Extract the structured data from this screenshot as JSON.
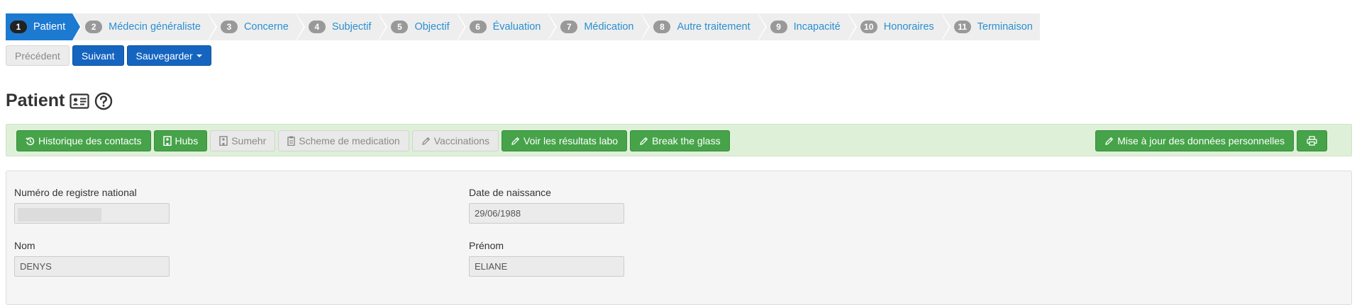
{
  "wizard": {
    "steps": [
      {
        "num": "1",
        "label": "Patient",
        "active": true
      },
      {
        "num": "2",
        "label": "Médecin généraliste"
      },
      {
        "num": "3",
        "label": "Concerne"
      },
      {
        "num": "4",
        "label": "Subjectif"
      },
      {
        "num": "5",
        "label": "Objectif"
      },
      {
        "num": "6",
        "label": "Évaluation"
      },
      {
        "num": "7",
        "label": "Médication"
      },
      {
        "num": "8",
        "label": "Autre traitement"
      },
      {
        "num": "9",
        "label": "Incapacité"
      },
      {
        "num": "10",
        "label": "Honoraires"
      },
      {
        "num": "11",
        "label": "Terminaison"
      }
    ]
  },
  "nav": {
    "previous_label": "Précédent",
    "next_label": "Suivant",
    "save_label": "Sauvegarder"
  },
  "page": {
    "title": "Patient",
    "icons": [
      "id-card-icon",
      "help-circle-icon"
    ]
  },
  "actions": {
    "contact_history": "Historique des contacts",
    "hubs": "Hubs",
    "sumehr": "Sumehr",
    "medication_scheme": "Scheme de medication",
    "vaccinations": "Vaccinations",
    "lab_results": "Voir les résultats labo",
    "break_glass": "Break the glass",
    "update_personal_data": "Mise à jour des données personnelles",
    "print_icon": "print-icon"
  },
  "form": {
    "national_number": {
      "label": "Numéro de registre national",
      "value": ""
    },
    "birth_date": {
      "label": "Date de naissance",
      "value": "29/06/1988"
    },
    "last_name": {
      "label": "Nom",
      "value": "DENYS"
    },
    "first_name": {
      "label": "Prénom",
      "value": "ELIANE"
    }
  },
  "colors": {
    "primary": "#1565c0",
    "active_step": "#1d7ad1",
    "link": "#2a8fd0",
    "success": "#46a349",
    "action_bar_bg": "#dff0d8"
  }
}
